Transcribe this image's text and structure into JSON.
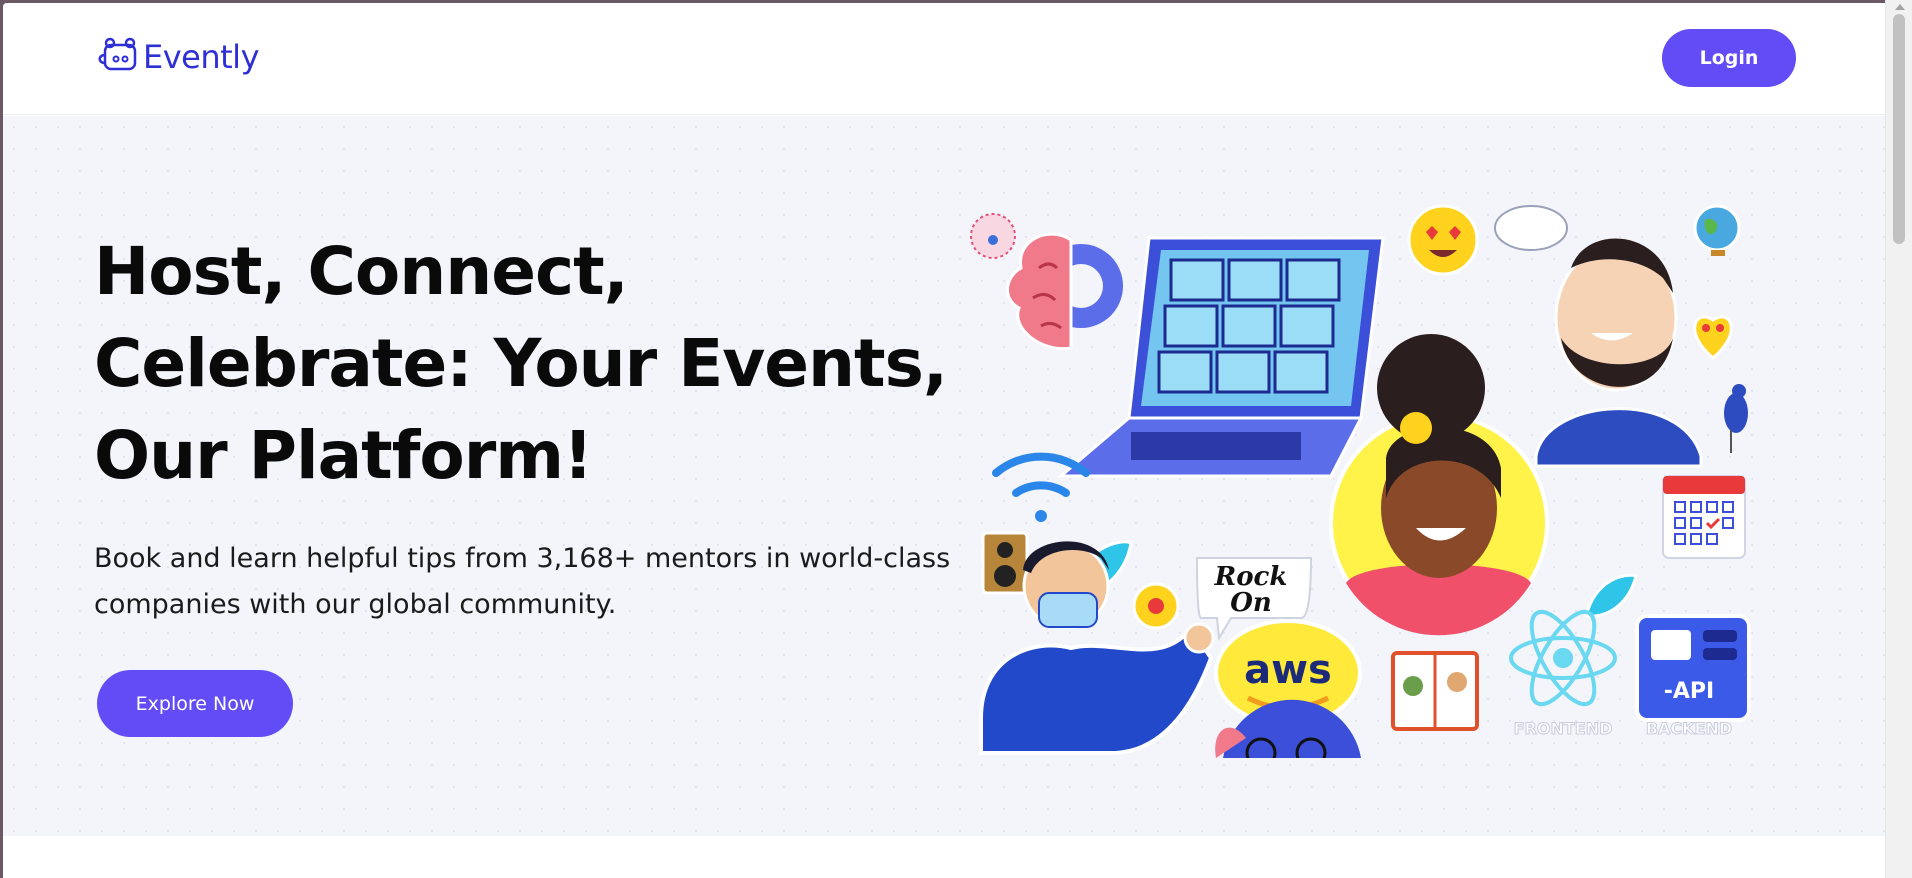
{
  "header": {
    "logo_text": "Evently",
    "login_label": "Login"
  },
  "hero": {
    "title_line1": "Host, Connect,",
    "title_line2": "Celebrate: Your Events,",
    "title_line3": "Our Platform!",
    "subtitle_line1": "Book and learn helpful tips from 3,168+ mentors in world-class",
    "subtitle_line2": "companies with our global community.",
    "cta_label": "Explore Now"
  },
  "illustration": {
    "sticker_rock_line1": "Rock",
    "sticker_rock_line2": "On",
    "aws_label": "aws",
    "api_label": "-API",
    "frontend_label": "FRONTEND",
    "backend_label": "BACKEND"
  },
  "colors": {
    "brand": "#624cf5",
    "logo": "#2f2fd6",
    "hero_bg": "#f4f5fa"
  }
}
